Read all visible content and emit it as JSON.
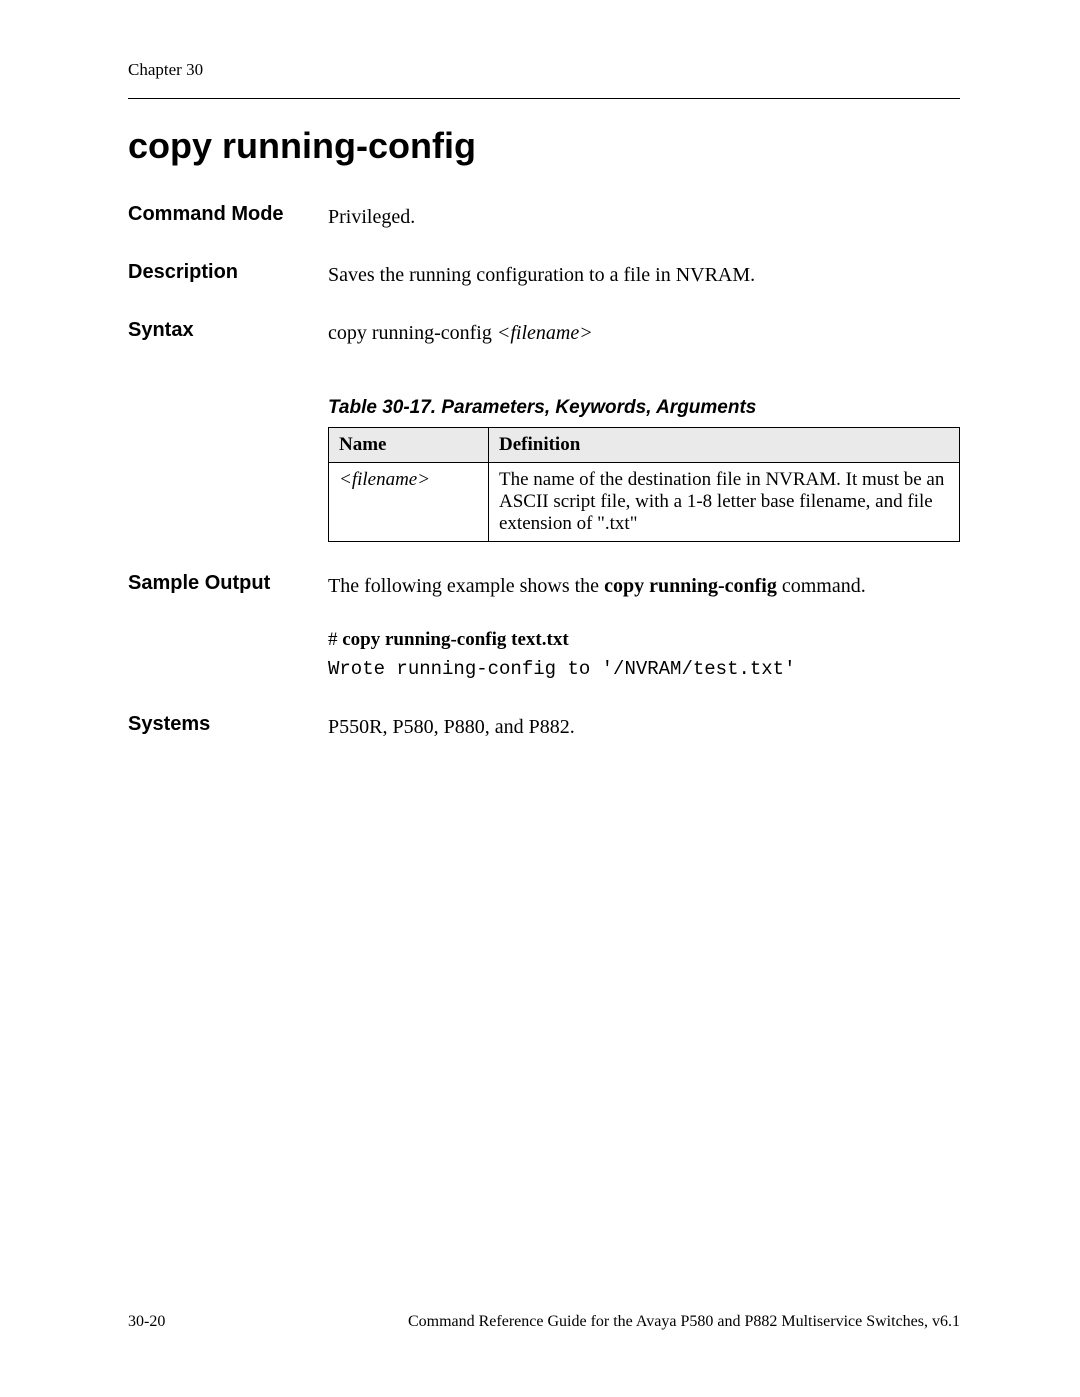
{
  "header": {
    "chapter": "Chapter 30"
  },
  "title": "copy running-config",
  "sections": {
    "command_mode": {
      "label": "Command Mode",
      "value": "Privileged."
    },
    "description": {
      "label": "Description",
      "value": "Saves the running configuration to a file in NVRAM."
    },
    "syntax": {
      "label": "Syntax",
      "cmd": "copy running-config ",
      "arg": "<filename>"
    },
    "sample_output": {
      "label": "Sample Output",
      "intro_pre": "The following example shows the ",
      "intro_bold": "copy running-config",
      "intro_post": " command.",
      "prompt": "#  ",
      "cmd": "copy running-config text.txt",
      "output": "Wrote running-config to '/NVRAM/test.txt'"
    },
    "systems": {
      "label": "Systems",
      "value": "P550R, P580, P880, and P882."
    }
  },
  "table": {
    "caption": "Table 30-17.  Parameters, Keywords, Arguments",
    "headers": {
      "name": "Name",
      "definition": "Definition"
    },
    "rows": [
      {
        "name": "<filename>",
        "definition": "The name of the destination file in NVRAM. It must be an ASCII script file, with a 1-8 letter base filename, and file extension of \".txt\""
      }
    ]
  },
  "footer": {
    "page": "30-20",
    "doc": "Command Reference Guide for the Avaya P580 and P882 Multiservice Switches, v6.1"
  }
}
